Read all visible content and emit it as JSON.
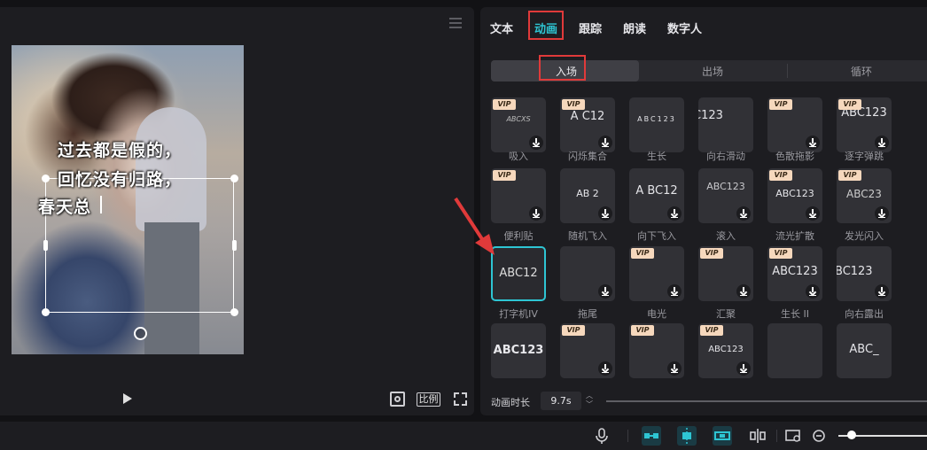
{
  "player": {
    "subtitle_lines": [
      "过去都是假的，",
      "回忆没有归路，",
      "春天总"
    ],
    "ratio_label": "比例"
  },
  "panel": {
    "tabs": [
      "文本",
      "动画",
      "跟踪",
      "朗读",
      "数字人"
    ],
    "active_tab": "动画",
    "subtabs": [
      "入场",
      "出场",
      "循环"
    ],
    "active_subtab": "入场",
    "effects": [
      {
        "label": "吸入",
        "preview": "ABCXS",
        "vip": true,
        "download": true
      },
      {
        "label": "闪烁集合",
        "preview": "A   C12",
        "vip": true,
        "download": true
      },
      {
        "label": "生长",
        "preview": "ABC123",
        "vip": false,
        "download": false
      },
      {
        "label": "向右滑动",
        "preview": "C123",
        "vip": false,
        "download": false
      },
      {
        "label": "色散拖影",
        "preview": "",
        "vip": true,
        "download": true
      },
      {
        "label": "逐字弹跳",
        "preview": "ABC123",
        "vip": true,
        "download": true
      },
      {
        "label": "便利贴",
        "preview": "",
        "vip": true,
        "download": true
      },
      {
        "label": "随机飞入",
        "preview": "AB   2",
        "vip": false,
        "download": true
      },
      {
        "label": "向下飞入",
        "preview": "A  BC12",
        "vip": false,
        "download": true
      },
      {
        "label": "滚入",
        "preview": "ABC123",
        "vip": false,
        "download": true
      },
      {
        "label": "流光扩散",
        "preview": "ABC123",
        "vip": true,
        "download": true
      },
      {
        "label": "发光闪入",
        "preview": "ABC23",
        "vip": true,
        "download": true
      },
      {
        "label": "打字机IV",
        "preview": "ABC12",
        "vip": false,
        "download": false
      },
      {
        "label": "拖尾",
        "preview": "",
        "vip": false,
        "download": true
      },
      {
        "label": "电光",
        "preview": "",
        "vip": true,
        "download": true
      },
      {
        "label": "汇聚",
        "preview": "",
        "vip": true,
        "download": true
      },
      {
        "label": "生长 II",
        "preview": "ABC123",
        "vip": true,
        "download": true
      },
      {
        "label": "向右露出",
        "preview": "BC123",
        "vip": false,
        "download": true
      },
      {
        "label": "",
        "preview": "ABC123",
        "vip": false,
        "download": false
      },
      {
        "label": "",
        "preview": "",
        "vip": true,
        "download": true
      },
      {
        "label": "",
        "preview": "",
        "vip": true,
        "download": true
      },
      {
        "label": "",
        "preview": "ABC123",
        "vip": true,
        "download": true
      },
      {
        "label": "",
        "preview": "",
        "vip": false,
        "download": false
      },
      {
        "label": "",
        "preview": "ABC_",
        "vip": false,
        "download": false
      }
    ],
    "selected_effect": "打字机IV",
    "vip_badge": "VIP",
    "duration_label": "动画时长",
    "duration_value": "9.7s"
  },
  "colors": {
    "accent": "#2ec5d3",
    "annotation": "#e03a3a",
    "vip": "#f6d8bd"
  }
}
